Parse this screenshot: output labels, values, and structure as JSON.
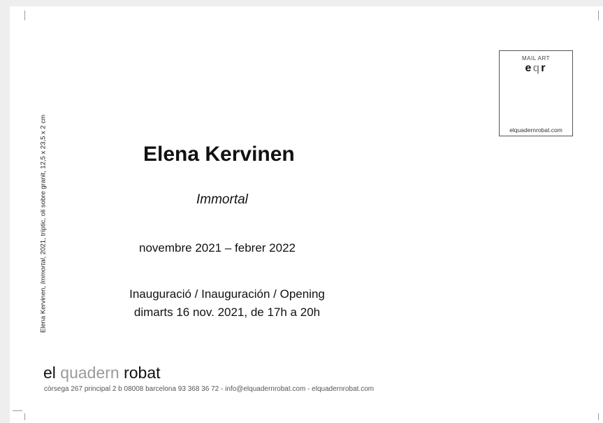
{
  "side_caption": {
    "before": "Elena Kervinen, ",
    "italic": "Immortal",
    "after": ", 2021, tríptic, oli sobre granit, 12,5 x 23,5 x 2 cm"
  },
  "stamp": {
    "label": "MAIL ART",
    "logo_e": "e",
    "logo_q": "q",
    "logo_r": "r",
    "url": "elquadernrobat.com"
  },
  "artist": "Elena Kervinen",
  "title": "Immortal",
  "dates": "novembre 2021 – febrer 2022",
  "opening": {
    "line1": "Inauguració / Inauguración / Opening",
    "line2": "dimarts 16 nov. 2021, de 17h a 20h"
  },
  "brand": {
    "el": "el",
    "quadern": "quadern",
    "robat": "robat"
  },
  "address": "còrsega 267 principal 2 b  08008 barcelona  93 368 36 72 - info@elquadernrobat.com - elquadernrobat.com",
  "colors": {
    "background": "#eeeeee",
    "card": "#ffffff",
    "grey_text": "#9a9a9a"
  }
}
